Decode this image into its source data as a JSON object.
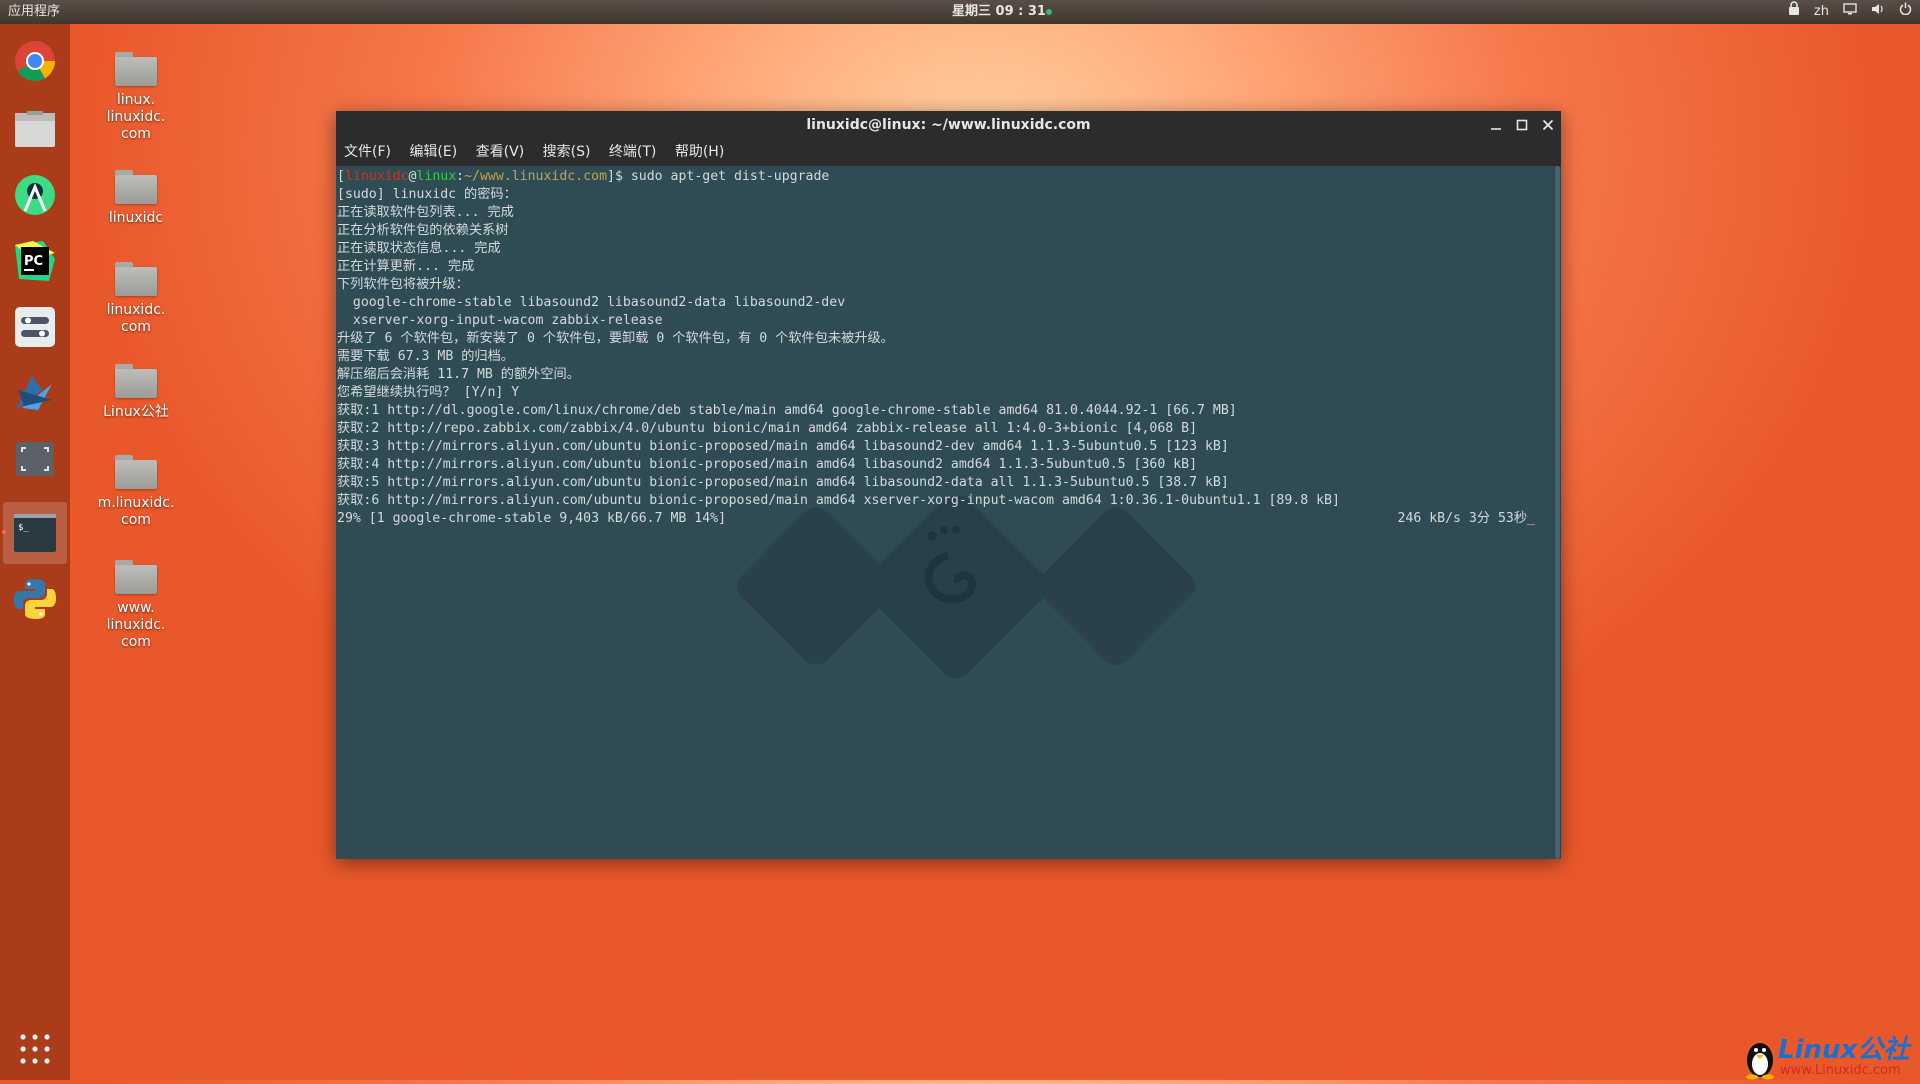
{
  "topbar": {
    "apps_label": "应用程序",
    "clock": "星期三 09 : 31",
    "lang": "zh"
  },
  "dock": {
    "items": [
      "chrome-icon",
      "files-icon",
      "android-studio-icon",
      "pycharm-icon",
      "settings-icon",
      "xcode-icon",
      "screenshot-icon",
      "terminal-icon",
      "python-icon"
    ],
    "show_apps": "show-apps-icon"
  },
  "desktop": {
    "icons": [
      {
        "label": "linux.\nlinuxidc.\ncom"
      },
      {
        "label": "linuxidc"
      },
      {
        "label": "linuxidc.\ncom"
      },
      {
        "label": "Linux公社"
      },
      {
        "label": "m.linuxidc.\ncom"
      },
      {
        "label": "www.\nlinuxidc.\ncom"
      }
    ]
  },
  "terminal": {
    "title": "linuxidc@linux: ~/www.linuxidc.com",
    "menu": [
      "文件(F)",
      "编辑(E)",
      "查看(V)",
      "搜索(S)",
      "终端(T)",
      "帮助(H)"
    ],
    "prompt": {
      "open": "[",
      "user": "linuxidc",
      "at": "@",
      "host": "linux",
      "colon": ":",
      "path": "~/www.linuxidc.com",
      "close": "]$ ",
      "command": "sudo apt-get dist-upgrade"
    },
    "output": [
      "[sudo] linuxidc 的密码：",
      "正在读取软件包列表... 完成",
      "正在分析软件包的依赖关系树",
      "正在读取状态信息... 完成",
      "正在计算更新... 完成",
      "下列软件包将被升级：",
      "  google-chrome-stable libasound2 libasound2-data libasound2-dev",
      "  xserver-xorg-input-wacom zabbix-release",
      "升级了 6 个软件包，新安装了 0 个软件包，要卸载 0 个软件包，有 0 个软件包未被升级。",
      "需要下载 67.3 MB 的归档。",
      "解压缩后会消耗 11.7 MB 的额外空间。",
      "您希望继续执行吗？ [Y/n] Y",
      "获取:1 http://dl.google.com/linux/chrome/deb stable/main amd64 google-chrome-stable amd64 81.0.4044.92-1 [66.7 MB]",
      "获取:2 http://repo.zabbix.com/zabbix/4.0/ubuntu bionic/main amd64 zabbix-release all 1:4.0-3+bionic [4,068 B]",
      "获取:3 http://mirrors.aliyun.com/ubuntu bionic-proposed/main amd64 libasound2-dev amd64 1.1.3-5ubuntu0.5 [123 kB]",
      "获取:4 http://mirrors.aliyun.com/ubuntu bionic-proposed/main amd64 libasound2 amd64 1.1.3-5ubuntu0.5 [360 kB]",
      "获取:5 http://mirrors.aliyun.com/ubuntu bionic-proposed/main amd64 libasound2-data all 1.1.3-5ubuntu0.5 [38.7 kB]",
      "获取:6 http://mirrors.aliyun.com/ubuntu bionic-proposed/main amd64 xserver-xorg-input-wacom amd64 1:0.36.1-0ubuntu1.1 [89.8 kB]"
    ],
    "progress_left": "29% [1 google-chrome-stable 9,403 kB/66.7 MB 14%]",
    "progress_right": "246 kB/s 3分 53秒_"
  },
  "logo": {
    "text": "Linux公社",
    "url": "www.Linuxidc.com"
  }
}
